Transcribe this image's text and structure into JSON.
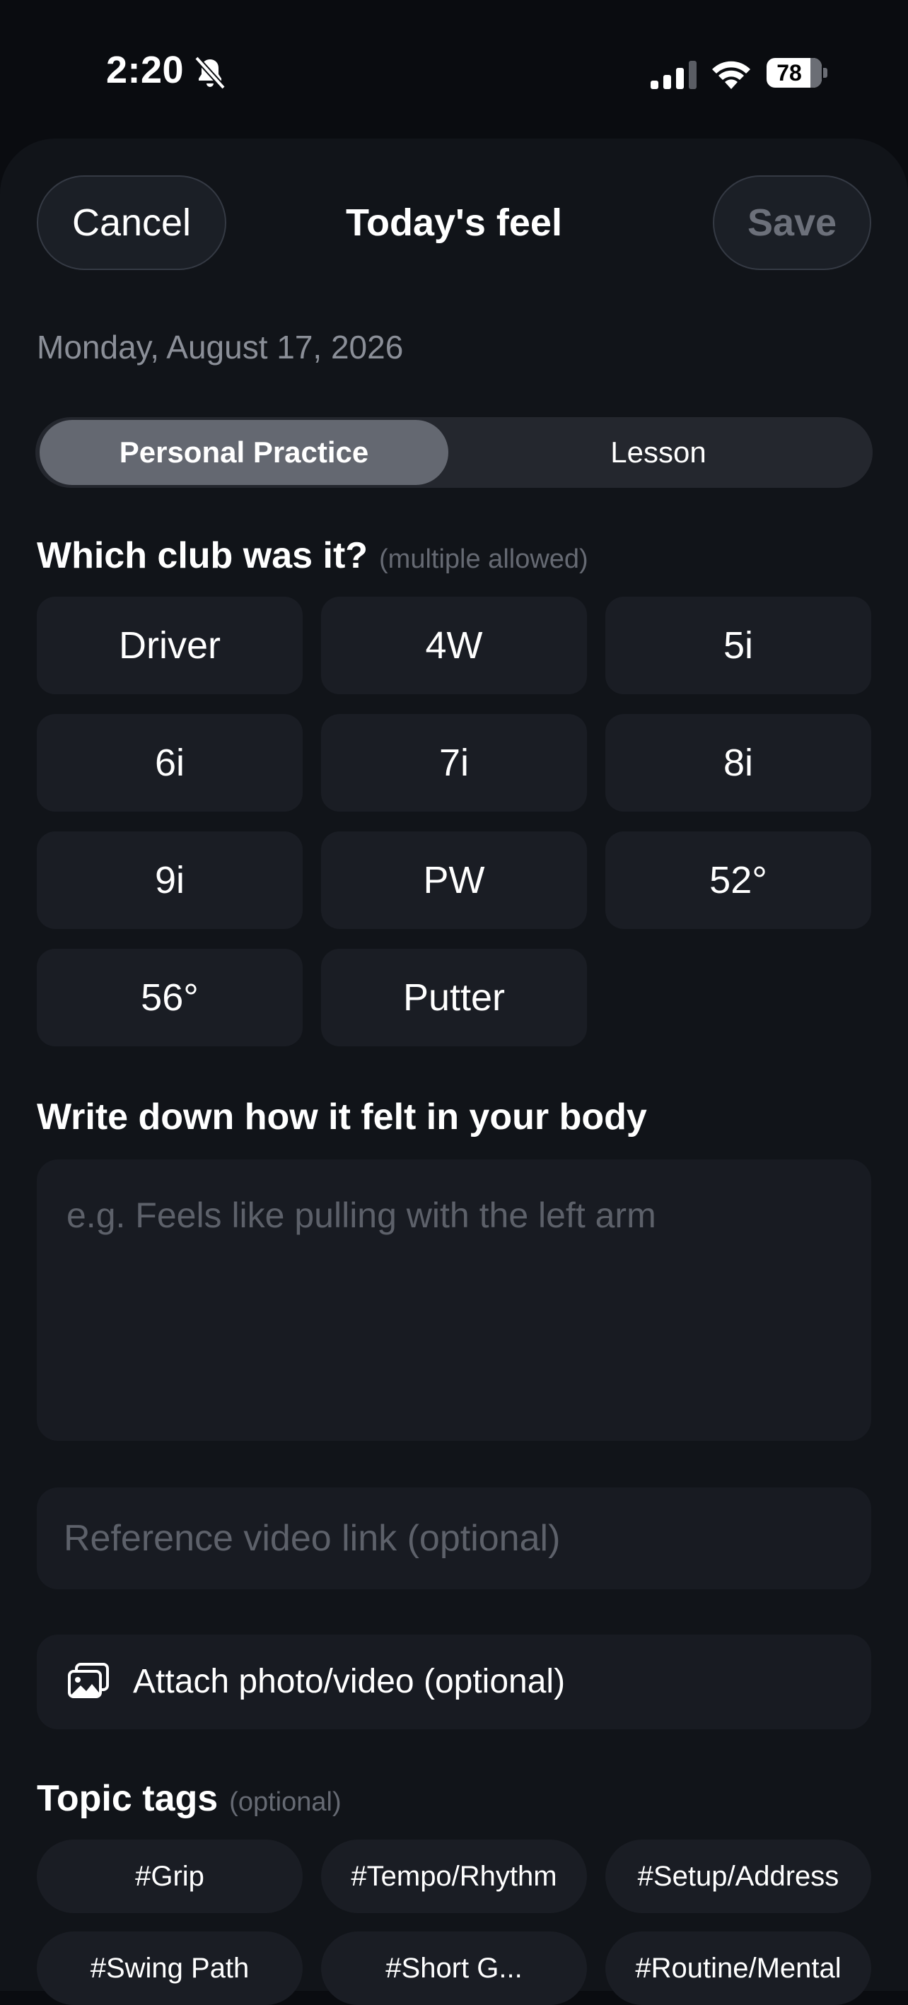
{
  "status_bar": {
    "time": "2:20",
    "battery_level": "78",
    "icons": [
      "bell-slash-icon",
      "cellular-signal-icon",
      "wifi-icon",
      "battery-icon"
    ]
  },
  "header": {
    "cancel_label": "Cancel",
    "title": "Today's feel",
    "save_label": "Save"
  },
  "date": "Monday, August 17, 2026",
  "mode_tabs": [
    {
      "label": "Personal Practice",
      "selected": true
    },
    {
      "label": "Lesson",
      "selected": false
    }
  ],
  "clubs_section": {
    "title": "Which club was it?",
    "hint": "(multiple allowed)"
  },
  "clubs": [
    "Driver",
    "4W",
    "5i",
    "6i",
    "7i",
    "8i",
    "9i",
    "PW",
    "52°",
    "56°",
    "Putter"
  ],
  "feel_section": {
    "title": "Write down how it felt in your body",
    "placeholder": "e.g. Feels like pulling with the left arm"
  },
  "video_link": {
    "placeholder": "Reference video link (optional)"
  },
  "attach": {
    "label": "Attach photo/video (optional)",
    "icon": "photo-gallery-icon"
  },
  "tags_section": {
    "title": "Topic tags",
    "hint": "(optional)"
  },
  "tags": [
    "#Grip",
    "#Tempo/Rhythm",
    "#Setup/Address",
    "#Swing Path",
    "#Short G...",
    "#Routine/Mental"
  ],
  "colors": {
    "background": "#0a0c10",
    "sheet": "#111419",
    "card": "#1a1d24",
    "selected_tab": "#646871",
    "placeholder": "#5d616a",
    "disabled_text": "#6c707a"
  }
}
